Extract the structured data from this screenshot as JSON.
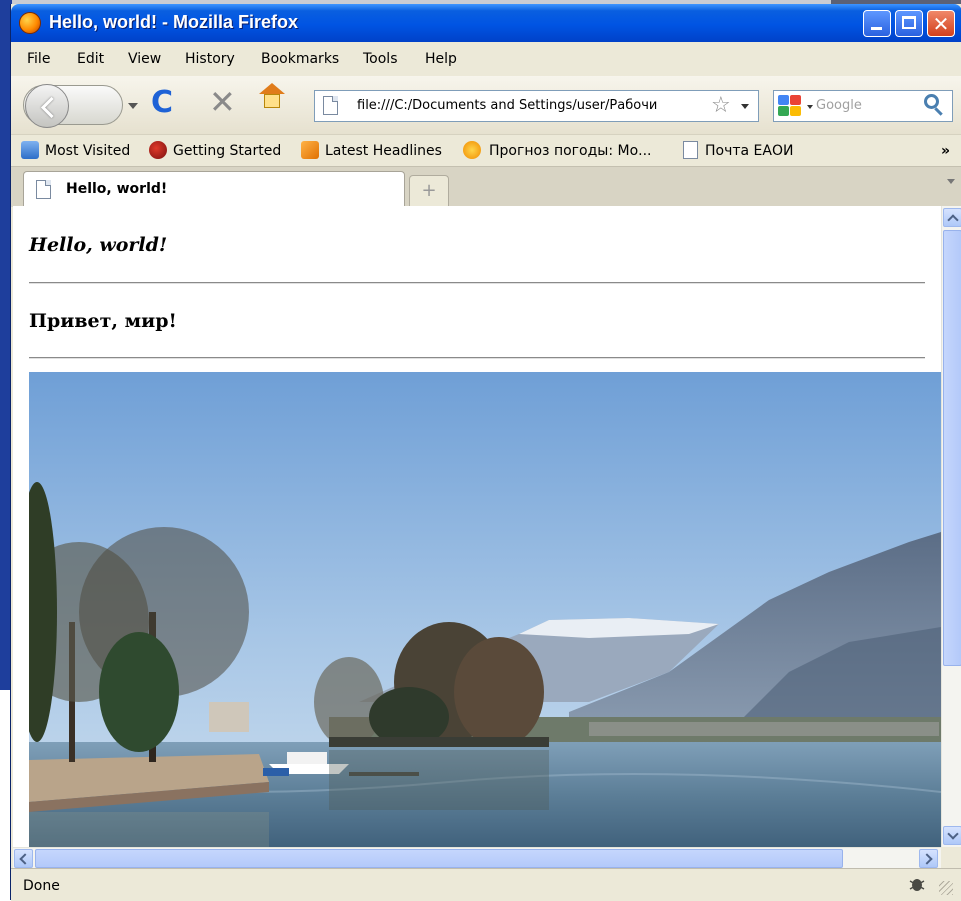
{
  "window": {
    "title": "Hello, world! - Mozilla Firefox",
    "controls": {
      "minimize": "_",
      "maximize": "□",
      "close": "✕"
    }
  },
  "menu": {
    "items": [
      {
        "label": "File"
      },
      {
        "label": "Edit"
      },
      {
        "label": "View"
      },
      {
        "label": "History"
      },
      {
        "label": "Bookmarks"
      },
      {
        "label": "Tools"
      },
      {
        "label": "Help"
      }
    ]
  },
  "navigation": {
    "reload_glyph": "C",
    "stop_glyph": "✕",
    "address": "file:///C:/Documents and Settings/user/Рабочи",
    "bookmark_star_glyph": "☆",
    "search_placeholder": "Google"
  },
  "bookmarks": {
    "items": [
      {
        "label": "Most Visited",
        "icon": "most-visited-icon"
      },
      {
        "label": "Getting Started",
        "icon": "firefox-icon"
      },
      {
        "label": "Latest Headlines",
        "icon": "rss-icon"
      },
      {
        "label": "Прогноз погоды: Мо...",
        "icon": "weather-icon"
      },
      {
        "label": "Почта ЕАОИ",
        "icon": "page-icon"
      }
    ],
    "overflow": "»"
  },
  "tabs": {
    "active_title": "Hello, world!",
    "new_tab_glyph": "+"
  },
  "page": {
    "heading_en": "Hello, world!",
    "heading_ru": "Привет, мир!",
    "image": "lake-mountain-photo"
  },
  "scrollbars": {
    "up": "⌃",
    "down": "⌄",
    "left": "<",
    "right": ">"
  },
  "status": {
    "text": "Done"
  },
  "colors": {
    "titlebar": "#0054e3",
    "chrome": "#ece9d8",
    "scrollbar_accent": "#b3c9fa"
  }
}
